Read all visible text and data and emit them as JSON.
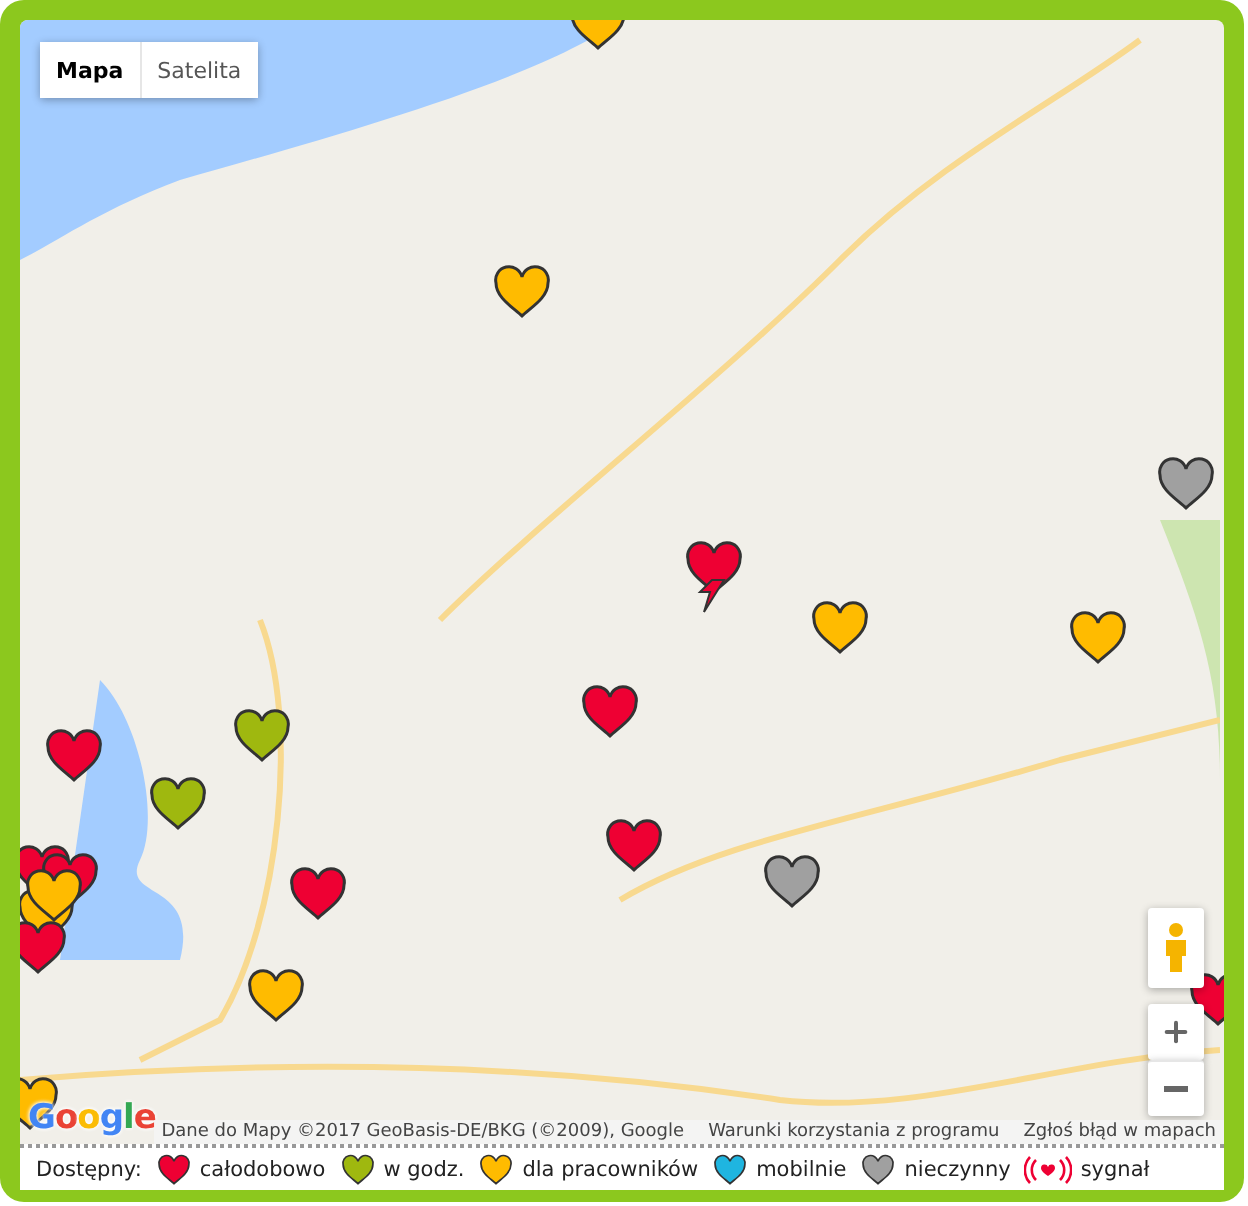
{
  "map_type_tabs": [
    {
      "label": "Mapa",
      "selected": true
    },
    {
      "label": "Satelita",
      "selected": false
    }
  ],
  "markers": [
    {
      "kind": "heart",
      "color": "#ffbb00"
    },
    {
      "kind": "heart",
      "color": "#ffbb00"
    },
    {
      "kind": "heart",
      "color": "#a0a0a0"
    },
    {
      "kind": "alert",
      "color": "#ee0033"
    },
    {
      "kind": "heart",
      "color": "#ffbb00"
    },
    {
      "kind": "heart",
      "color": "#ffbb00"
    },
    {
      "kind": "heart",
      "color": "#ee0033"
    },
    {
      "kind": "heart",
      "color": "#9fb80f"
    },
    {
      "kind": "heart",
      "color": "#ee0033"
    },
    {
      "kind": "heart",
      "color": "#9fb80f"
    },
    {
      "kind": "heart",
      "color": "#ee0033"
    },
    {
      "kind": "heart",
      "color": "#ee0033"
    },
    {
      "kind": "heart",
      "color": "#a0a0a0"
    },
    {
      "kind": "heart",
      "color": "#ffbb00"
    },
    {
      "kind": "heart",
      "color": "#ee0033"
    },
    {
      "kind": "heart",
      "color": "#ee0033"
    },
    {
      "kind": "heart",
      "color": "#ee0033"
    },
    {
      "kind": "heart",
      "color": "#ffbb00"
    },
    {
      "kind": "heart",
      "color": "#ffbb00"
    },
    {
      "kind": "heart",
      "color": "#ee0033"
    },
    {
      "kind": "heart",
      "color": "#ffbb00"
    }
  ],
  "google_logo": "Google",
  "attribution": [
    "Dane do Mapy ©2017 GeoBasis-DE/BKG (©2009), Google",
    "Warunki korzystania z programu",
    "Zgłoś błąd w mapach"
  ],
  "legend": {
    "title": "Dostępny:",
    "items": [
      {
        "kind": "heart",
        "color": "#ee0033",
        "label": "całodobowo"
      },
      {
        "kind": "heart",
        "color": "#9fb80f",
        "label": "w godz."
      },
      {
        "kind": "heart",
        "color": "#ffbb00",
        "label": "dla pracowników"
      },
      {
        "kind": "heart",
        "color": "#1fb5e0",
        "label": "mobilnie"
      },
      {
        "kind": "heart",
        "color": "#a0a0a0",
        "label": "nieczynny"
      },
      {
        "kind": "signal",
        "color": "#ee0033",
        "label": "sygnał"
      }
    ]
  }
}
